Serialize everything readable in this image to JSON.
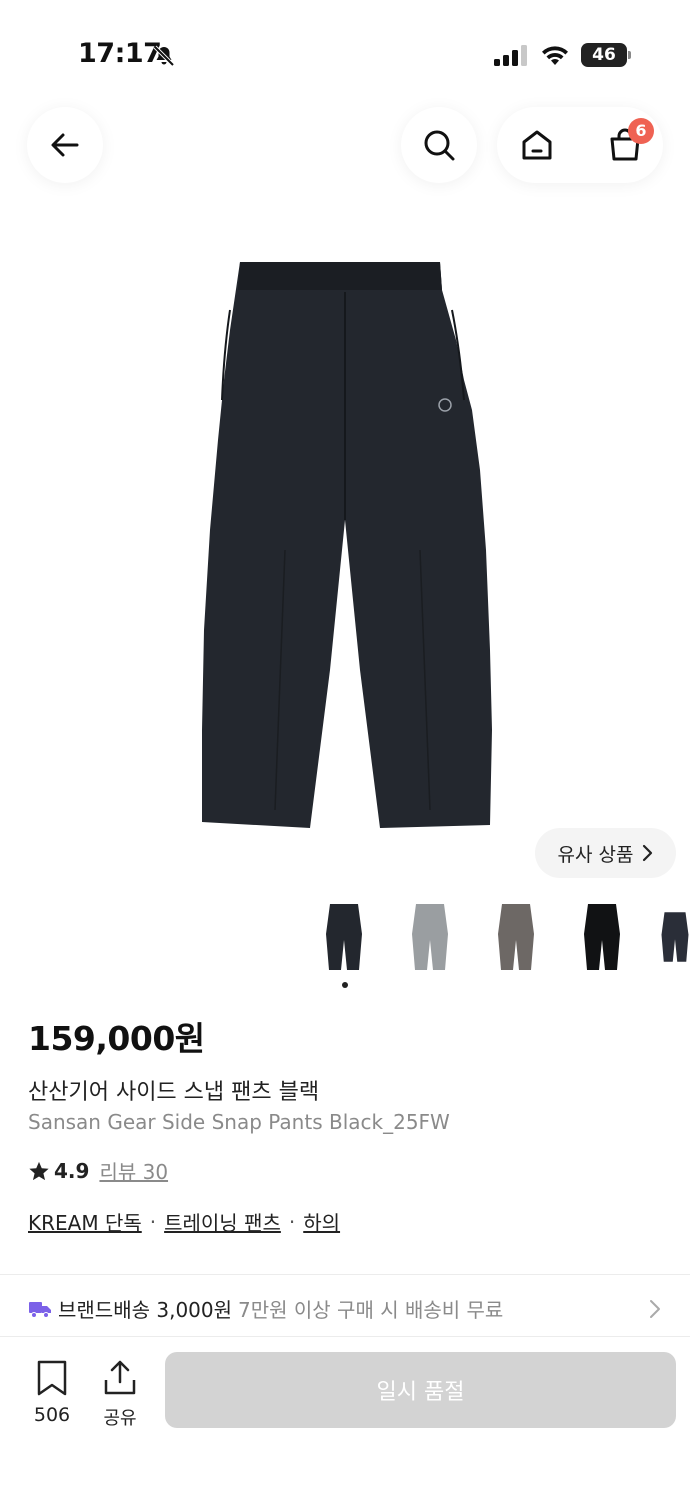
{
  "status_bar": {
    "time": "17:17",
    "battery": "46"
  },
  "nav": {
    "cart_count": "6"
  },
  "gallery": {
    "similar_label": "유사 상품"
  },
  "product": {
    "price": "159,000원",
    "name_ko": "산산기어 사이드 스냅 팬츠 블랙",
    "name_en": "Sansan Gear Side Snap Pants Black_25FW",
    "rating": "4.9",
    "review_label": "리뷰 30",
    "tags": [
      "KREAM 단독",
      "트레이닝 팬츠",
      "하의"
    ]
  },
  "shipping": {
    "label": "브랜드배송 3,000원",
    "sub": "7만원 이상 구매 시 배송비 무료"
  },
  "bottom_bar": {
    "bookmark_count": "506",
    "share_label": "공유",
    "action_label": "일시 품절"
  },
  "colors": {
    "accent_badge": "#ef6253",
    "truck": "#7b61e8",
    "soldout": "#d3d3d3"
  },
  "icons": [
    "bell-slash-icon",
    "signal-icon",
    "wifi-icon",
    "back-arrow-icon",
    "search-icon",
    "home-icon",
    "cart-icon",
    "chevron-right-icon",
    "star-icon",
    "truck-icon",
    "bookmark-icon",
    "share-icon"
  ]
}
